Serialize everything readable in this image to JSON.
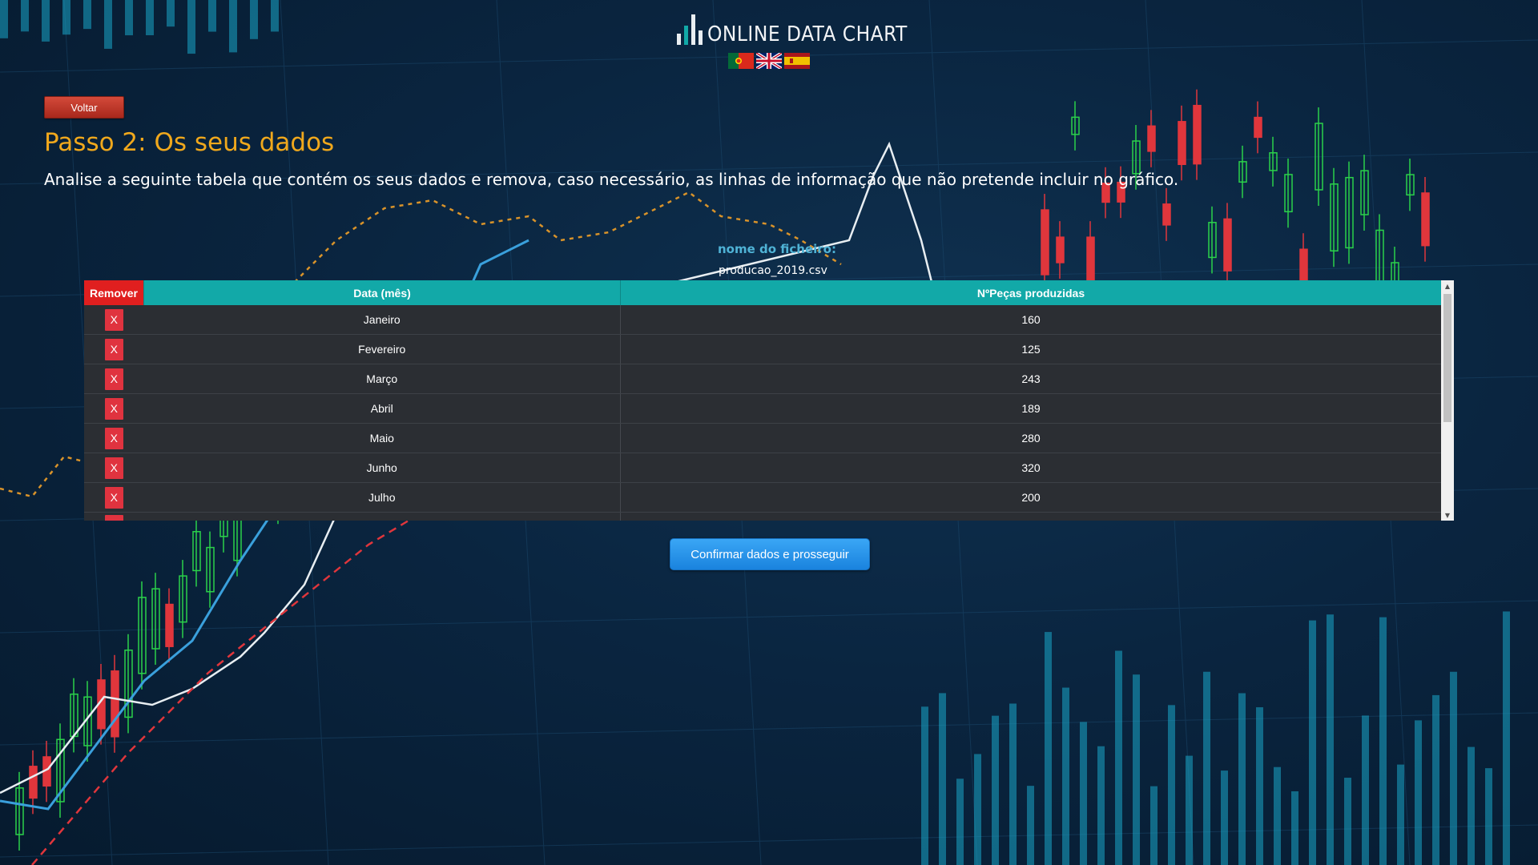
{
  "header": {
    "logo_text": "ONLINE DATA CHART",
    "flags": [
      "portugal-flag-icon",
      "uk-flag-icon",
      "spain-flag-icon"
    ]
  },
  "back_button": {
    "label": "Voltar"
  },
  "step": {
    "title": "Passo 2: Os seus dados",
    "description": "Analise a seguinte tabela que contém os seus dados e remova, caso necessário, as linhas de informação que não pretende incluir no gráfico."
  },
  "file": {
    "label": "nome do ficheiro:",
    "name": "producao_2019.csv"
  },
  "table": {
    "headers": {
      "remove": "Remover",
      "month": "Data (mês)",
      "value": "NºPeças produzidas"
    },
    "remove_label": "X",
    "rows": [
      {
        "month": "Janeiro",
        "value": "160"
      },
      {
        "month": "Fevereiro",
        "value": "125"
      },
      {
        "month": "Março",
        "value": "243"
      },
      {
        "month": "Abril",
        "value": "189"
      },
      {
        "month": "Maio",
        "value": "280"
      },
      {
        "month": "Junho",
        "value": "320"
      },
      {
        "month": "Julho",
        "value": "200"
      }
    ]
  },
  "confirm_button": {
    "label": "Confirmar dados e prosseguir"
  },
  "colors": {
    "accent_orange": "#f0a81c",
    "header_teal": "#12a9a8",
    "remove_red": "#e01f1f",
    "confirm_blue": "#1a83de",
    "back_red": "#b83224"
  }
}
